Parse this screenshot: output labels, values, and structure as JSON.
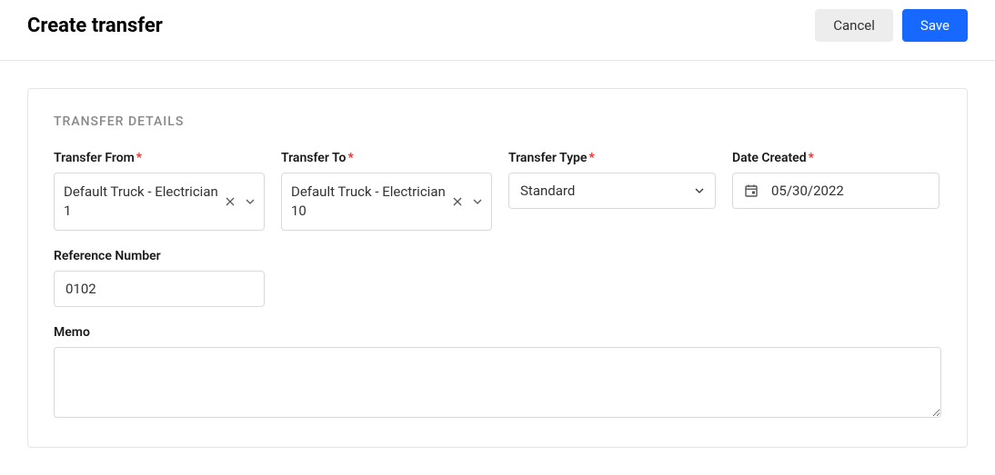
{
  "header": {
    "title": "Create transfer",
    "cancel_label": "Cancel",
    "save_label": "Save"
  },
  "card": {
    "title": "TRANSFER DETAILS"
  },
  "fields": {
    "transfer_from": {
      "label": "Transfer From",
      "value": "Default Truck - Electrician 1"
    },
    "transfer_to": {
      "label": "Transfer To",
      "value": "Default Truck - Electrician 10"
    },
    "transfer_type": {
      "label": "Transfer Type",
      "value": "Standard"
    },
    "date_created": {
      "label": "Date Created",
      "value": "05/30/2022"
    },
    "reference_number": {
      "label": "Reference Number",
      "value": "0102"
    },
    "memo": {
      "label": "Memo",
      "value": ""
    }
  }
}
